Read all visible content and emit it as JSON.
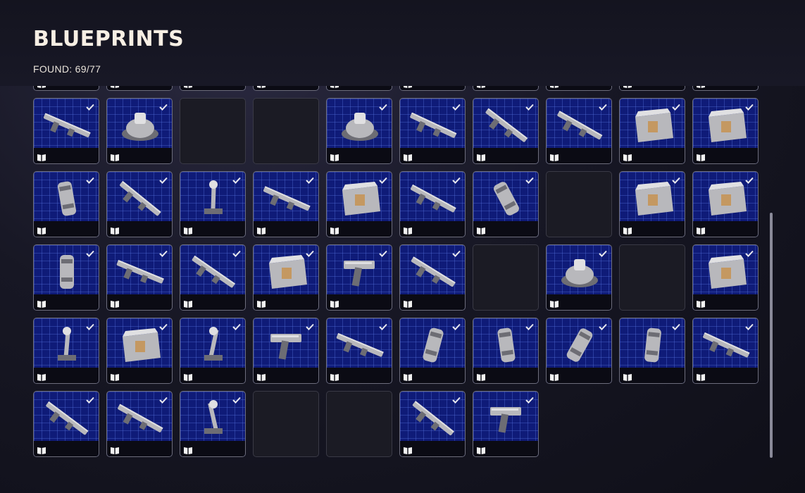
{
  "header": {
    "title": "BLUEPRINTS",
    "found_label": "FOUND: 69/77"
  },
  "colors": {
    "card_bg": "#0f1b78",
    "grid_line": "#5a78e6",
    "empty_bg": "#1b1b24",
    "text": "#f7efe4"
  },
  "rows": [
    [
      "found",
      "found",
      "found",
      "found",
      "found",
      "found",
      "found",
      "found",
      "found",
      "found"
    ],
    [
      "found",
      "found",
      "empty",
      "empty",
      "found",
      "found",
      "found",
      "found",
      "found",
      "found"
    ],
    [
      "found",
      "found",
      "found",
      "found",
      "found",
      "found",
      "found",
      "empty",
      "found",
      "found"
    ],
    [
      "found",
      "found",
      "found",
      "found",
      "found",
      "found",
      "empty",
      "found",
      "empty",
      "found"
    ],
    [
      "found",
      "found",
      "found",
      "found",
      "found",
      "found",
      "found",
      "found",
      "found",
      "found"
    ],
    [
      "found",
      "found",
      "found",
      "empty",
      "empty",
      "found",
      "found"
    ]
  ],
  "items": [
    [
      "rifle",
      "rifle",
      "rifle",
      "rifle",
      "rifle",
      "rifle",
      "rifle",
      "rifle",
      "rifle",
      "rifle"
    ],
    [
      "rifle-icon",
      "turret-icon",
      "",
      "",
      "mine-icon",
      "tube-icon",
      "smg-icon",
      "sniper-icon",
      "crate-icon",
      "case-icon"
    ],
    [
      "barrel-icon",
      "rifle-icon",
      "hammer-icon",
      "scope-icon",
      "ammo-box-icon",
      "stock-icon",
      "grenade-pack-icon",
      "",
      "supply-crate-icon",
      "toolbox-icon"
    ],
    [
      "armor-icon",
      "long-rifle-icon",
      "magazine-icon",
      "briefcase-icon",
      "carbine-icon",
      "assault-rifle-icon",
      "",
      "drone-icon",
      "",
      "crate-icon"
    ],
    [
      "jack-icon",
      "kit-icon",
      "tripod-icon",
      "pistol-icon",
      "stock-frame-icon",
      "shell-icon",
      "canister-icon",
      "lantern-icon",
      "grenade-icon",
      "flashlight-icon"
    ],
    [
      "tube-icon",
      "launcher-icon",
      "nozzle-icon",
      "",
      "",
      "smg-icon",
      "tool-gun-icon"
    ]
  ]
}
